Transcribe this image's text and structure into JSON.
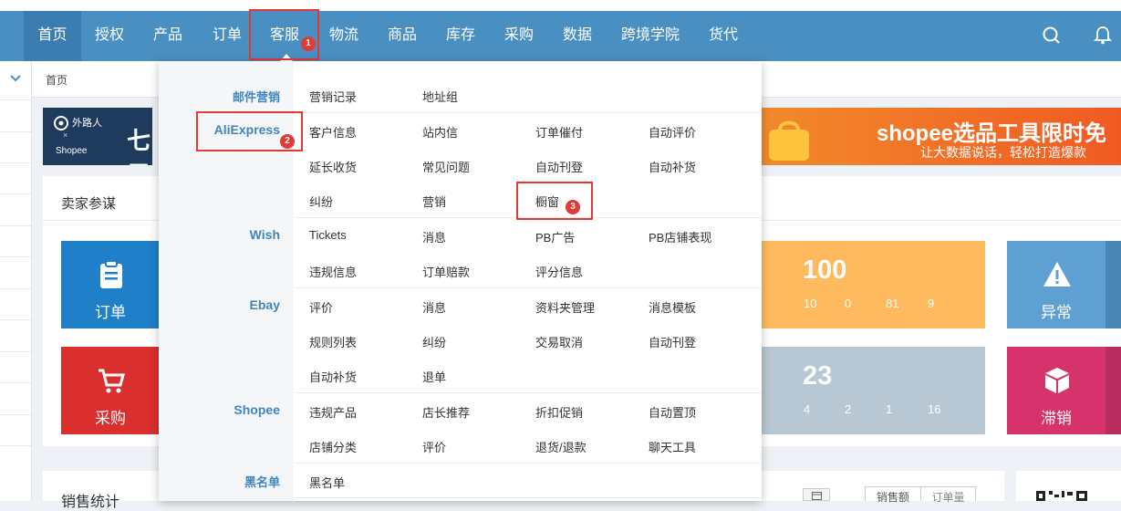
{
  "nav": {
    "items": [
      "首页",
      "授权",
      "产品",
      "订单",
      "客服",
      "物流",
      "商品",
      "库存",
      "采购",
      "数据",
      "跨境学院",
      "货代"
    ],
    "icons": [
      "search-icon",
      "bell-icon"
    ]
  },
  "breadcrumb": "首页",
  "banner": {
    "left_brand": "外路人",
    "left_cross": "×",
    "left_shopee": "Shopee",
    "left_big": "七元",
    "right_title": "shopee选品工具限时免",
    "right_sub": "让大数据说话，轻松打造爆款"
  },
  "panel": {
    "title": "卖家参谋"
  },
  "tiles": {
    "order": "订单",
    "purchase": "采购",
    "abnormal": "异常",
    "slow": "滞销"
  },
  "stats": {
    "top": {
      "big": "100",
      "small": [
        "10",
        "0",
        "81",
        "9"
      ]
    },
    "bottom": {
      "big": "23",
      "small": [
        "4",
        "2",
        "1",
        "16"
      ]
    }
  },
  "sales": {
    "title": "销售统计",
    "tab1": "销售额",
    "tab2": "订单量"
  },
  "annotations": {
    "b1": "1",
    "b2": "2",
    "b3": "3"
  },
  "menu": {
    "categories": {
      "email": "邮件营销",
      "aliexpress": "AliExpress",
      "wish": "Wish",
      "ebay": "Ebay",
      "shopee": "Shopee",
      "blacklist": "黑名单"
    },
    "email": [
      "营销记录",
      "地址组"
    ],
    "aliexpress": [
      "客户信息",
      "站内信",
      "订单催付",
      "自动评价",
      "延长收货",
      "常见问题",
      "自动刊登",
      "自动补货",
      "纠纷",
      "营销",
      "橱窗"
    ],
    "wish": [
      "Tickets",
      "消息",
      "PB广告",
      "PB店铺表现",
      "违规信息",
      "订单赔款",
      "评分信息"
    ],
    "ebay": [
      "评价",
      "消息",
      "资料夹管理",
      "消息模板",
      "规则列表",
      "纠纷",
      "交易取消",
      "自动刊登",
      "自动补货",
      "退单"
    ],
    "shopee": [
      "违规产品",
      "店长推荐",
      "折扣促销",
      "自动置顶",
      "店铺分类",
      "评价",
      "退货/退款",
      "聊天工具"
    ],
    "blacklist": [
      "黑名单"
    ]
  },
  "colors": {
    "nav_bg": "#4a8fc1",
    "accent": "#3f86c0",
    "annotation_red": "#e53935",
    "tile_blue": "#1f7fc9",
    "tile_red": "#d9302f",
    "tile_orange": "#ffb95e",
    "tile_gray": "#b7c7d3",
    "tile_steel": "#5fa0d2",
    "tile_pink": "#d6336c"
  }
}
